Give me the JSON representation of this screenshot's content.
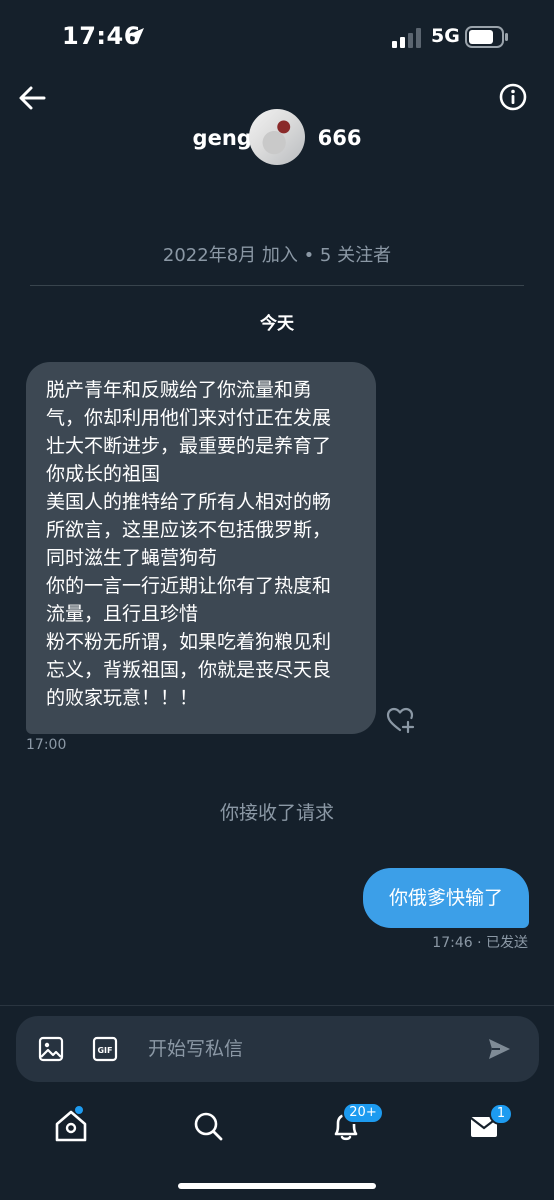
{
  "status_bar": {
    "time": "17:46",
    "network": "5G"
  },
  "header": {
    "username": "geng         666",
    "profile_meta": "2022年8月 加入 • 5 关注者",
    "back_icon": "arrow-left-icon",
    "info_icon": "info-circle-icon"
  },
  "conversation": {
    "date_separator": "今天",
    "incoming": {
      "lines": [
        "脱产青年和反贼给了你流量和勇",
        "气，你却利用他们来对付正在发展",
        "壮大不断进步，最重要的是养育了",
        "你成长的祖国",
        "美国人的推特给了所有人相对的畅",
        "所欲言，这里应该不包括俄罗斯，",
        "同时滋生了蝇营狗苟",
        "你的一言一行近期让你有了热度和",
        "流量，且行且珍惜",
        "粉不粉无所谓，如果吃着狗粮见利",
        "忘义，背叛祖国，你就是丧尽天良",
        "的败家玩意！！！"
      ],
      "time": "17:00"
    },
    "system_note": "你接收了请求",
    "outgoing": {
      "text": "你俄爹快输了",
      "status": "17:46 · 已发送"
    }
  },
  "composer": {
    "placeholder": "开始写私信",
    "gif_label": "GIF"
  },
  "tab_bar": {
    "notifications_badge": "20+",
    "messages_badge": "1"
  },
  "colors": {
    "background": "#15202b",
    "incoming_bubble": "#3d4853",
    "outgoing_bubble": "#3c9fe8",
    "accent": "#1d9bf0",
    "muted_text": "#8b98a5"
  }
}
